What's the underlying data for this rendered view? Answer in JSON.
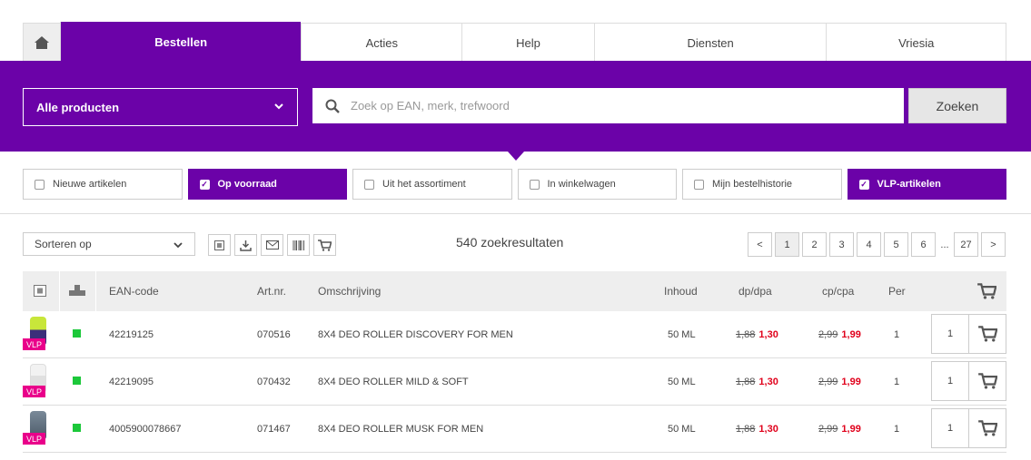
{
  "tabs": [
    {
      "label": "Bestellen"
    },
    {
      "label": "Acties"
    },
    {
      "label": "Help"
    },
    {
      "label": "Diensten"
    },
    {
      "label": "Vriesia"
    }
  ],
  "search": {
    "category": "Alle producten",
    "placeholder": "Zoek op EAN, merk, trefwoord",
    "button": "Zoeken"
  },
  "filters": [
    {
      "label": "Nieuwe artikelen",
      "checked": false
    },
    {
      "label": "Op voorraad",
      "checked": true
    },
    {
      "label": "Uit het assortiment",
      "checked": false
    },
    {
      "label": "In winkelwagen",
      "checked": false
    },
    {
      "label": "Mijn bestelhistorie",
      "checked": false
    },
    {
      "label": "VLP-artikelen",
      "checked": true
    }
  ],
  "toolbar": {
    "sort_label": "Sorteren op",
    "results_text": "540 zoekresultaten"
  },
  "pagination": {
    "prev": "<",
    "pages": [
      "1",
      "2",
      "3",
      "4",
      "5",
      "6"
    ],
    "ellipsis": "...",
    "last": "27",
    "next": ">",
    "current": "1"
  },
  "table": {
    "columns": {
      "ean": "EAN-code",
      "artnr": "Art.nr.",
      "desc": "Omschrijving",
      "inhoud": "Inhoud",
      "dp": "dp/dpa",
      "cp": "cp/cpa",
      "per": "Per"
    },
    "rows": [
      {
        "badge": "VLP",
        "ean": "42219125",
        "artnr": "070516",
        "desc": "8X4 DEO ROLLER DISCOVERY FOR MEN",
        "inhoud": "50 ML",
        "dp_old": "1,88",
        "dp_new": "1,30",
        "cp_old": "2,99",
        "cp_new": "1,99",
        "per": "1",
        "qty": "1",
        "thumb_color": "#c8e63a"
      },
      {
        "badge": "VLP",
        "ean": "42219095",
        "artnr": "070432",
        "desc": "8X4 DEO ROLLER MILD & SOFT",
        "inhoud": "50 ML",
        "dp_old": "1,88",
        "dp_new": "1,30",
        "cp_old": "2,99",
        "cp_new": "1,99",
        "per": "1",
        "qty": "1",
        "thumb_color": "#e8e8e8"
      },
      {
        "badge": "VLP",
        "ean": "4005900078667",
        "artnr": "071467",
        "desc": "8X4 DEO ROLLER MUSK FOR MEN",
        "inhoud": "50 ML",
        "dp_old": "1,88",
        "dp_new": "1,30",
        "cp_old": "2,99",
        "cp_new": "1,99",
        "per": "1",
        "qty": "1",
        "thumb_color": "#5a6a7a"
      }
    ]
  },
  "colors": {
    "brand_purple": "#6b02a8",
    "price_red": "#e0001b",
    "vlp_pink": "#e9008a",
    "stock_green": "#1cc83a"
  }
}
